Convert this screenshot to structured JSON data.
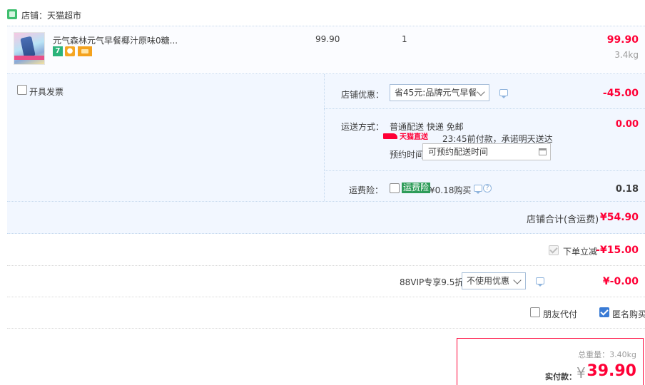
{
  "shop": {
    "label": "店铺：天猫超市"
  },
  "item": {
    "title": "元气森林元气早餐椰汁原味0糖...",
    "badge_1": "7",
    "price": "99.90",
    "quantity": "1",
    "total": "99.90",
    "weight": "3.4kg"
  },
  "invoice": {
    "label": "开具发票"
  },
  "shop_discount": {
    "label": "店铺优惠：",
    "selected": "省45元:品牌元气早餐",
    "amount": "-45.00"
  },
  "shipping": {
    "label": "运送方式：",
    "method": "普通配送 快递 免邮",
    "tmall_badge": "天猫直送",
    "promise": "23:45前付款，承诺明天送达",
    "reserve_label": "预约时间",
    "reserve_placeholder": "可预约配送时间",
    "amount": "0.00"
  },
  "insurance": {
    "label": "运费险：",
    "tag": "运费险",
    "price": "¥0.18购买",
    "amount": "0.18"
  },
  "shop_total": {
    "label": "店铺合计(含运费)",
    "amount": "¥54.90"
  },
  "order_discount": {
    "label": "下单立减",
    "amount": "-¥15.00"
  },
  "vip": {
    "label": "88VIP专享9.5折",
    "selected": "不使用优惠",
    "amount": "¥-0.00"
  },
  "friend_pay": {
    "label": "朋友代付",
    "checked": false
  },
  "anonymous": {
    "label": "匿名购买",
    "checked": true
  },
  "summary": {
    "weight_label": "总重量：",
    "weight": "3.40kg",
    "pay_label": "实付款：",
    "currency": "¥",
    "amount": "39.90"
  },
  "colors": {
    "accent_red": "#ff0036",
    "panel_bg": "#f2f7ff",
    "checkbox_blue": "#3a7bd5",
    "insurance_green": "#2e9c59"
  }
}
